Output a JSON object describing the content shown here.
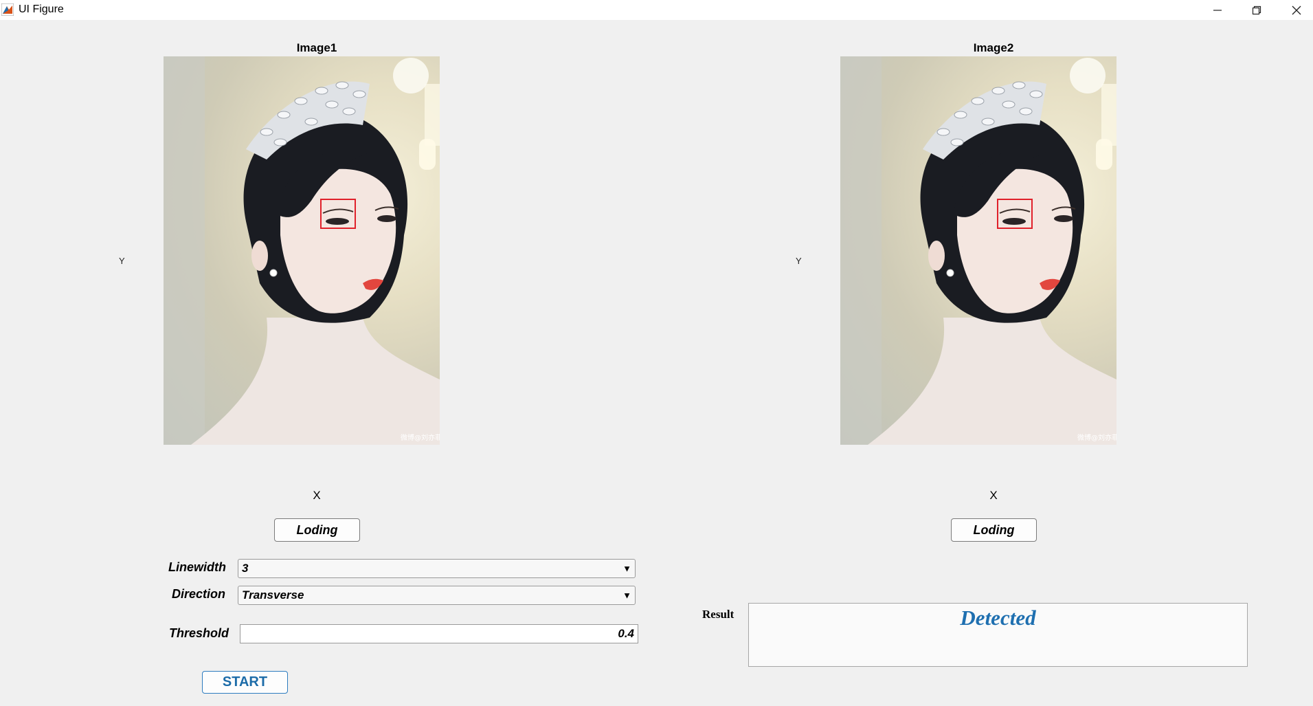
{
  "window": {
    "title": "UI Figure",
    "buttons": [
      "minimize",
      "restore",
      "close"
    ]
  },
  "panels": [
    {
      "title": "Image1",
      "xlabel": "X",
      "ylabel": "Y",
      "load_button": "Loding",
      "watermark": "微博@刘亦菲"
    },
    {
      "title": "Image2",
      "xlabel": "X",
      "ylabel": "Y",
      "load_button": "Loding",
      "watermark": "微博@刘亦菲"
    }
  ],
  "controls": {
    "linewidth": {
      "label": "Linewidth",
      "value": "3"
    },
    "direction": {
      "label": "Direction",
      "value": "Transverse"
    },
    "threshold": {
      "label": "Threshold",
      "value": "0.4"
    },
    "start_button": "START"
  },
  "result": {
    "label": "Result",
    "value": "Detected",
    "color": "#1e6fb0"
  },
  "colors": {
    "detection_box": "#e0202a",
    "accent": "#2c7bbf",
    "window_bg": "#f0f0f0"
  }
}
